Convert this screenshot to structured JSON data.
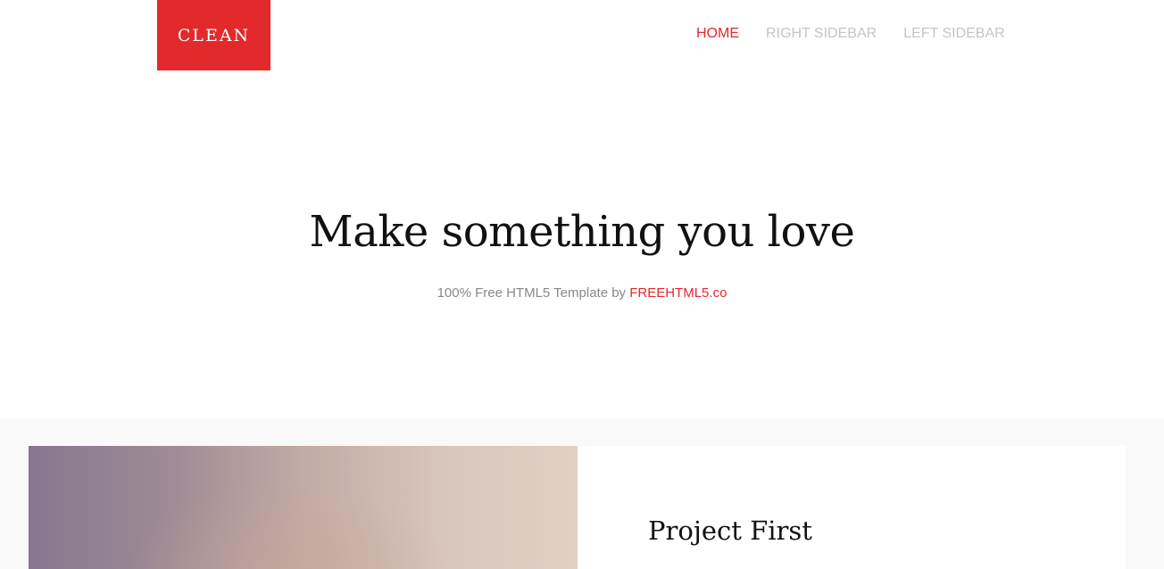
{
  "header": {
    "logo_text": "CLEAN",
    "nav": [
      {
        "label": "HOME",
        "active": true
      },
      {
        "label": "RIGHT SIDEBAR",
        "active": false
      },
      {
        "label": "LEFT SIDEBAR",
        "active": false
      }
    ]
  },
  "hero": {
    "title": "Make something you love",
    "subtitle_prefix": "100% Free HTML5 Template by ",
    "subtitle_link": "FREEHTML5.co"
  },
  "projects": {
    "first_title": "Project First"
  },
  "colors": {
    "accent": "#e2292c",
    "nav_inactive": "#c4c4c4",
    "section_bg": "#f9f9f9"
  }
}
